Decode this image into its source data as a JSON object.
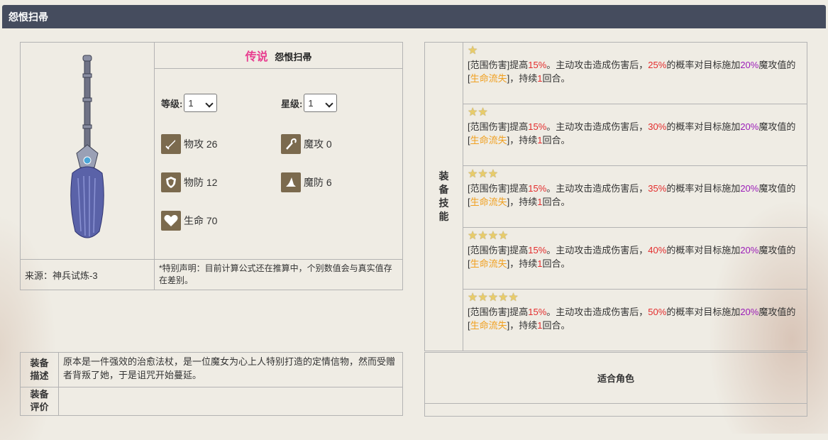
{
  "title": "怨恨扫帚",
  "item": {
    "rarity": "传说",
    "name": "怨恨扫帚",
    "level_label": "等级:",
    "level_value": "1",
    "star_label": "星级:",
    "star_value": "1",
    "stats": [
      {
        "icon": "sword-icon",
        "label": "物攻 26"
      },
      {
        "icon": "magic-staff-icon",
        "label": "魔攻 0"
      },
      {
        "icon": "shield-icon",
        "label": "物防 12"
      },
      {
        "icon": "wizard-hat-icon",
        "label": "魔防 6"
      },
      {
        "icon": "heart-icon",
        "label": "生命 70"
      }
    ],
    "source": "来源：神兵试炼-3",
    "note": "*特别声明：目前计算公式还在推算中，个别数值会与真实值存在差别。"
  },
  "skills": {
    "header": "装备技能",
    "tiers": [
      {
        "stars": 1,
        "prefix": "[范围伤害]提高",
        "boost": "15%",
        "mid": "。主动攻击造成伤害后，",
        "chance": "25%",
        "mid2": "的概率对目标施加",
        "ratio": "20%",
        "mid3": "魔攻值的[",
        "effect": "生命流失",
        "suffix": "]，持续",
        "turns": "1",
        "end": "回合。"
      },
      {
        "stars": 2,
        "prefix": "[范围伤害]提高",
        "boost": "15%",
        "mid": "。主动攻击造成伤害后，",
        "chance": "30%",
        "mid2": "的概率对目标施加",
        "ratio": "20%",
        "mid3": "魔攻值的[",
        "effect": "生命流失",
        "suffix": "]，持续",
        "turns": "1",
        "end": "回合。"
      },
      {
        "stars": 3,
        "prefix": "[范围伤害]提高",
        "boost": "15%",
        "mid": "。主动攻击造成伤害后，",
        "chance": "35%",
        "mid2": "的概率对目标施加",
        "ratio": "20%",
        "mid3": "魔攻值的[",
        "effect": "生命流失",
        "suffix": "]，持续",
        "turns": "1",
        "end": "回合。"
      },
      {
        "stars": 4,
        "prefix": "[范围伤害]提高",
        "boost": "15%",
        "mid": "。主动攻击造成伤害后，",
        "chance": "40%",
        "mid2": "的概率对目标施加",
        "ratio": "20%",
        "mid3": "魔攻值的[",
        "effect": "生命流失",
        "suffix": "]，持续",
        "turns": "1",
        "end": "回合。"
      },
      {
        "stars": 5,
        "prefix": "[范围伤害]提高",
        "boost": "15%",
        "mid": "。主动攻击造成伤害后，",
        "chance": "50%",
        "mid2": "的概率对目标施加",
        "ratio": "20%",
        "mid3": "魔攻值的[",
        "effect": "生命流失",
        "suffix": "]，持续",
        "turns": "1",
        "end": "回合。"
      }
    ]
  },
  "description": {
    "desc_header": "装备描述",
    "desc_text": "原本是一件强效的治愈法杖，是一位魔女为心上人特别打造的定情信物，然而受赠者背叛了她，于是诅咒开始蔓延。",
    "review_header": "装备评价",
    "review_text": ""
  },
  "roles": {
    "header": "适合角色"
  },
  "colors": {
    "titlebar": "#454c5e",
    "rarity": "#e83c8f",
    "highlight_red": "#e32d2d",
    "highlight_purple": "#9b1db8",
    "highlight_orange": "#f0a020",
    "stat_icon_bg": "#7b6a4e"
  }
}
